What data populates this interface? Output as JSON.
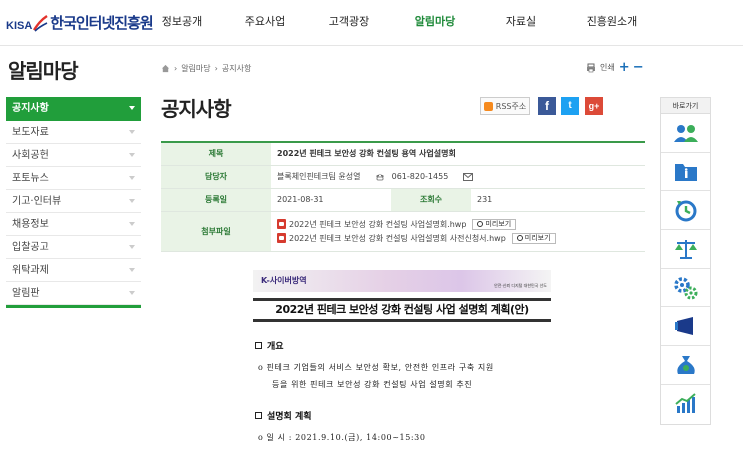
{
  "header": {
    "logo_kisa": "KISA",
    "logo_name": "한국인터넷진흥원",
    "menu": [
      {
        "label": "정보공개"
      },
      {
        "label": "주요사업"
      },
      {
        "label": "고객광장"
      },
      {
        "label": "알림마당",
        "active": true
      },
      {
        "label": "자료실"
      },
      {
        "label": "진흥원소개"
      }
    ]
  },
  "sidebar": {
    "title": "알림마당",
    "items": [
      {
        "label": "공지사항",
        "active": true
      },
      {
        "label": "보도자료"
      },
      {
        "label": "사회공헌"
      },
      {
        "label": "포토뉴스"
      },
      {
        "label": "기고·인터뷰"
      },
      {
        "label": "채용정보"
      },
      {
        "label": "입찰공고"
      },
      {
        "label": "위탁과제"
      },
      {
        "label": "알림판"
      }
    ]
  },
  "breadcrumb": {
    "items": [
      "알림마당",
      "공지사항"
    ]
  },
  "utils": {
    "print_label": "인쇄"
  },
  "page": {
    "title": "공지사항",
    "rss_label": "RSS주소"
  },
  "notice": {
    "title_label": "제목",
    "title_value": "2022년 핀테크 보안성 강화 컨설팅 용역 사업설명회",
    "manager_label": "담당자",
    "manager_value": "블록체인핀테크팀 윤성열",
    "phone": "061-820-1455",
    "date_label": "등록일",
    "date_value": "2021-08-31",
    "views_label": "조회수",
    "views_value": "231",
    "files_label": "첨부파일",
    "files": [
      {
        "name": "2022년 핀테크 보안성 강화 컨설팅 사업설명회.hwp",
        "preview": "미리보기"
      },
      {
        "name": "2022년 핀테크 보안성 강화 컨설팅 사업설명회 사전신청서.hwp",
        "preview": "미리보기"
      }
    ]
  },
  "doc": {
    "banner_left": "K-사이버방역",
    "banner_right": "안전·신뢰 디지털 대한민국 선도",
    "title": "2022년 핀테크 보안성 강화 컨설팅 사업 설명회 계획(안)",
    "sections": [
      {
        "heading": "개요",
        "lines": [
          "o  핀테크 기업들의 서비스 보안성 확보, 안전한 인프라 구축 지원",
          "등을 위한 핀테크 보안성 강화 컨설팅 사업 설명회 추진"
        ]
      },
      {
        "heading": "설명회 계획",
        "lines": [
          "o 일      시 : 2021.9.10.(금), 14:00~15:30"
        ]
      }
    ]
  },
  "quick_menu": {
    "title": "바로가기",
    "icons": [
      "people-icon",
      "info-folder-icon",
      "clock-icon",
      "scales-icon",
      "gears-icon",
      "megaphone-icon",
      "money-bag-icon",
      "chart-icon"
    ]
  },
  "colors": {
    "primary_green": "#219e3b",
    "brand_blue": "#1a3a8a",
    "table_header_bg": "#e9f3e6"
  }
}
